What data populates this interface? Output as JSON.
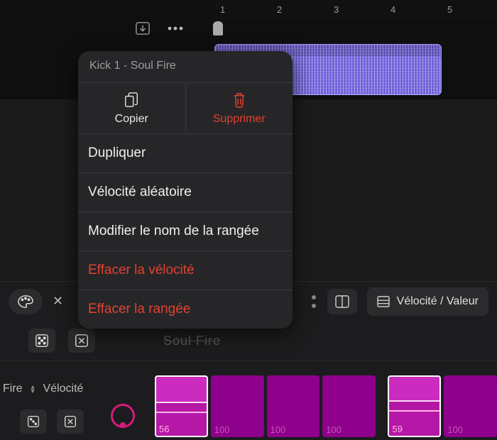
{
  "timeline": {
    "bars": [
      "1",
      "2",
      "3",
      "4",
      "5"
    ]
  },
  "context_menu": {
    "region_name": "Kick 1 - Soul Fire",
    "copy": "Copier",
    "delete": "Supprimer",
    "duplicate": "Dupliquer",
    "random_velocity": "Vélocité aléatoire",
    "rename_row": "Modifier le nom de la rangée",
    "clear_velocity": "Effacer la vélocité",
    "clear_row": "Effacer la rangée"
  },
  "midbar": {
    "mode_label": "Vélocité / Valeur"
  },
  "ghost_region": "Soul Fire",
  "row": {
    "name_suffix": "Fire",
    "lane_label": "Vélocité"
  },
  "steps": [
    {
      "value": "56",
      "active": true,
      "fill": 0.56
    },
    {
      "value": "100",
      "active": false,
      "fill": 1.0
    },
    {
      "value": "100",
      "active": false,
      "fill": 1.0
    },
    {
      "value": "100",
      "active": false,
      "fill": 1.0
    },
    {
      "value": "59",
      "active": true,
      "fill": 0.59
    },
    {
      "value": "100",
      "active": false,
      "fill": 1.0
    }
  ],
  "colors": {
    "accent_region": "#6e5fd9",
    "accent_pink": "#d81b7c",
    "accent_magenta": "#b517a6",
    "danger": "#e14231"
  }
}
